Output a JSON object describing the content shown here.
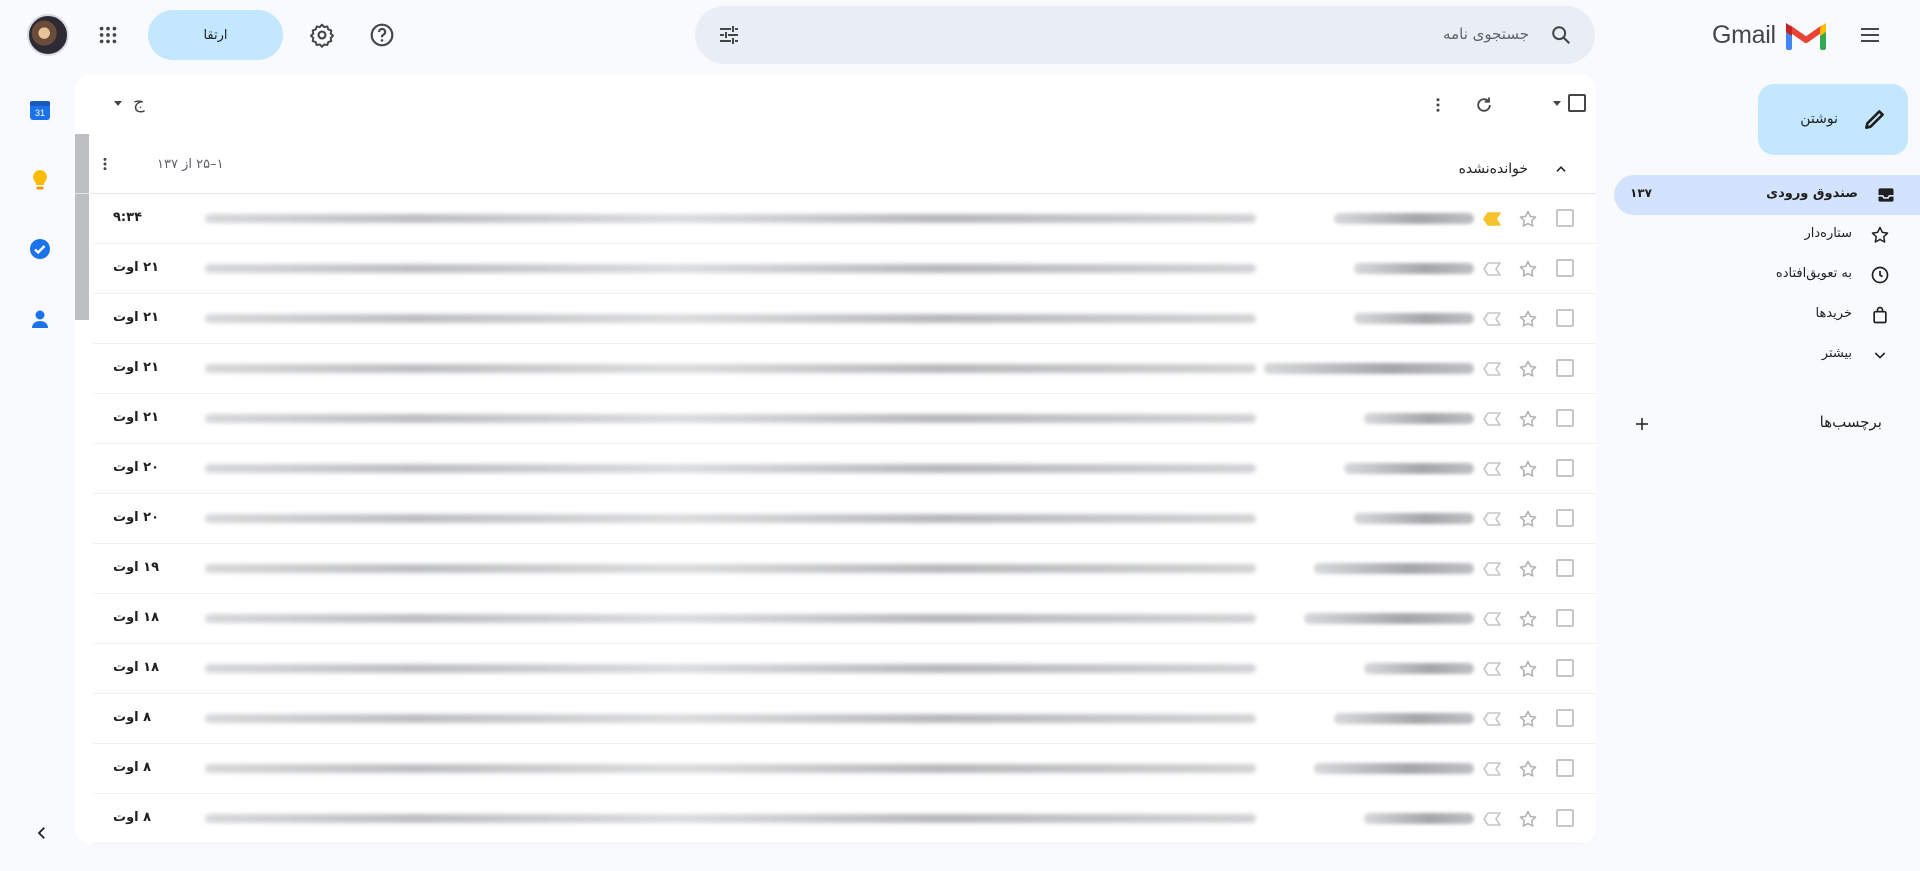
{
  "app": {
    "name": "Gmail"
  },
  "header": {
    "search_placeholder": "جستجوی نامه",
    "account_label": "ارتقا"
  },
  "compose": {
    "label": "نوشتن"
  },
  "nav": {
    "items": [
      {
        "label": "صندوق ورودی",
        "icon": "inbox-icon",
        "count": "۱۳۷",
        "active": true
      },
      {
        "label": "ستاره‌دار",
        "icon": "star-icon",
        "count": ""
      },
      {
        "label": "به تعویق‌افتاده",
        "icon": "clock-icon",
        "count": ""
      },
      {
        "label": "خریدها",
        "icon": "shopping-bag-icon",
        "count": ""
      },
      {
        "label": "بیشتر",
        "icon": "chevron-down-icon",
        "count": ""
      }
    ],
    "labels_title": "برچسب‌ها"
  },
  "toolbar": {
    "input_tool_glyph": "ج"
  },
  "section": {
    "title": "خوانده‌نشده",
    "page_range": "۱–۲۵ از ۱۳۷"
  },
  "emails": [
    {
      "date": "۹:۳۴",
      "important": true
    },
    {
      "date": "۲۱ اوت",
      "important": false
    },
    {
      "date": "۲۱ اوت",
      "important": false
    },
    {
      "date": "۲۱ اوت",
      "important": false
    },
    {
      "date": "۲۱ اوت",
      "important": false
    },
    {
      "date": "۲۰ اوت",
      "important": false
    },
    {
      "date": "۲۰ اوت",
      "important": false
    },
    {
      "date": "۱۹ اوت",
      "important": false
    },
    {
      "date": "۱۸ اوت",
      "important": false
    },
    {
      "date": "۱۸ اوت",
      "important": false
    },
    {
      "date": "۸ اوت",
      "important": false
    },
    {
      "date": "۸ اوت",
      "important": false
    },
    {
      "date": "۸ اوت",
      "important": false
    }
  ],
  "colors": {
    "accent": "#c2e7ff",
    "nav_active": "#d3e3fd",
    "important": "#f5c32c"
  }
}
